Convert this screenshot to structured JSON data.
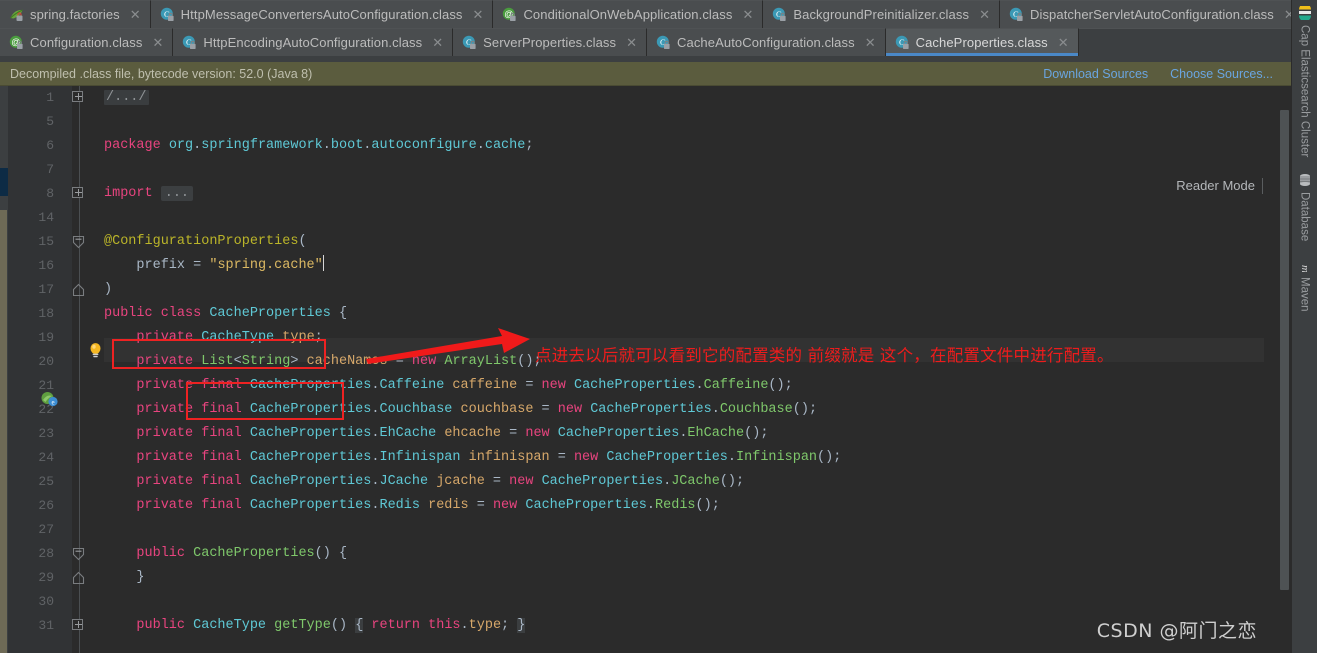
{
  "tabs_row1": [
    {
      "label": "spring.factories",
      "icon": "spring-leaf-icon",
      "active": false
    },
    {
      "label": "HttpMessageConvertersAutoConfiguration.class",
      "icon": "class-file-icon",
      "active": false
    },
    {
      "label": "ConditionalOnWebApplication.class",
      "icon": "annotation-file-icon",
      "active": false
    },
    {
      "label": "BackgroundPreinitializer.class",
      "icon": "class-file-icon",
      "active": false
    },
    {
      "label": "DispatcherServletAutoConfiguration.class",
      "icon": "class-file-icon",
      "active": false
    }
  ],
  "tabs_row2": [
    {
      "label": "Configuration.class",
      "icon": "annotation-file-icon",
      "active": false
    },
    {
      "label": "HttpEncodingAutoConfiguration.class",
      "icon": "class-file-icon",
      "active": false
    },
    {
      "label": "ServerProperties.class",
      "icon": "class-file-icon",
      "active": false
    },
    {
      "label": "CacheAutoConfiguration.class",
      "icon": "class-file-icon",
      "active": false
    },
    {
      "label": "CacheProperties.class",
      "icon": "class-file-icon",
      "active": true
    }
  ],
  "tab_close_glyph": "✕",
  "notification": {
    "message": "Decompiled .class file, bytecode version: 52.0 (Java 8)",
    "download_sources": "Download Sources",
    "choose_sources": "Choose Sources..."
  },
  "editor": {
    "reader_mode": "Reader Mode",
    "lines": [
      {
        "num": "1",
        "fold": "plus",
        "text": "/.../"
      },
      {
        "num": "5",
        "fold": "",
        "text": ""
      },
      {
        "num": "6",
        "fold": "",
        "text": "package org.springframework.boot.autoconfigure.cache;"
      },
      {
        "num": "7",
        "fold": "",
        "text": ""
      },
      {
        "num": "8",
        "fold": "plus",
        "text": "import ..."
      },
      {
        "num": "14",
        "fold": "",
        "text": ""
      },
      {
        "num": "15",
        "fold": "minus-arrow",
        "text": "@ConfigurationProperties("
      },
      {
        "num": "16",
        "fold": "",
        "text": "    prefix = \"spring.cache\""
      },
      {
        "num": "17",
        "fold": "end-arrow",
        "text": ")"
      },
      {
        "num": "18",
        "fold": "",
        "text": "public class CacheProperties {"
      },
      {
        "num": "19",
        "fold": "",
        "text": "    private CacheType type;"
      },
      {
        "num": "20",
        "fold": "",
        "text": "    private List<String> cacheNames = new ArrayList();"
      },
      {
        "num": "21",
        "fold": "",
        "text": "    private final CacheProperties.Caffeine caffeine = new CacheProperties.Caffeine();"
      },
      {
        "num": "22",
        "fold": "",
        "text": "    private final CacheProperties.Couchbase couchbase = new CacheProperties.Couchbase();"
      },
      {
        "num": "23",
        "fold": "",
        "text": "    private final CacheProperties.EhCache ehcache = new CacheProperties.EhCache();"
      },
      {
        "num": "24",
        "fold": "",
        "text": "    private final CacheProperties.Infinispan infinispan = new CacheProperties.Infinispan();"
      },
      {
        "num": "25",
        "fold": "",
        "text": "    private final CacheProperties.JCache jcache = new CacheProperties.JCache();"
      },
      {
        "num": "26",
        "fold": "",
        "text": "    private final CacheProperties.Redis redis = new CacheProperties.Redis();"
      },
      {
        "num": "27",
        "fold": "",
        "text": ""
      },
      {
        "num": "28",
        "fold": "minus-arrow",
        "text": "    public CacheProperties() {"
      },
      {
        "num": "29",
        "fold": "end-arrow",
        "text": "    }"
      },
      {
        "num": "30",
        "fold": "",
        "text": ""
      },
      {
        "num": "31",
        "fold": "plus",
        "text": "    public CacheType getType() { return this.type; }"
      }
    ]
  },
  "annotations": {
    "text": "点进去以后就可以看到它的配置类的 前缀就是 这个，在配置文件中进行配置。",
    "color": "#ee1c1c",
    "boxes": [
      "prefix = \"spring.cache\"",
      "CacheProperties {"
    ]
  },
  "right_sidebar": [
    {
      "label": "Cap Elasticsearch Cluster",
      "icon": "elasticsearch-icon"
    },
    {
      "label": "Database",
      "icon": "database-icon"
    },
    {
      "label": "Maven",
      "icon": "maven-icon"
    }
  ],
  "watermark": "CSDN @阿门之恋",
  "colors": {
    "accent_blue": "#4a88c7",
    "notif_bar": "#5b5c3e",
    "editor_bg": "#2b2b2b",
    "chrome_bg": "#3c3f41",
    "annotation_red": "#ee1c1c"
  }
}
